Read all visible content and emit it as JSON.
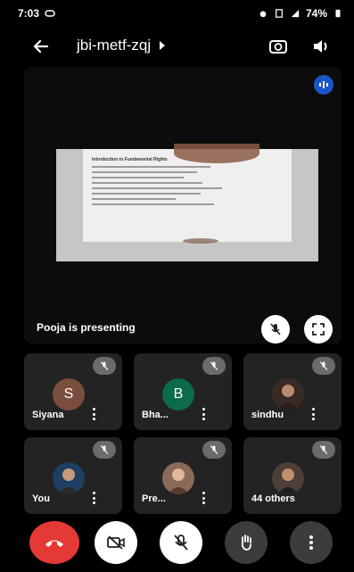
{
  "status_bar": {
    "time": "7:03",
    "battery": "74%"
  },
  "meeting": {
    "code": "jbi-metf-zqj"
  },
  "presentation": {
    "presenter_label": "Pooja is presenting",
    "slide_title": "Introduction to Fundamental Rights"
  },
  "participants": [
    {
      "name": "Siyana",
      "initial": "S",
      "avatar_color": "#7b4d3d",
      "muted": true
    },
    {
      "name": "Bha...",
      "initial": "B",
      "avatar_color": "#0c6b4a",
      "muted": true
    },
    {
      "name": "sindhu",
      "initial": "",
      "avatar_color": "#3a2a26",
      "muted": true
    },
    {
      "name": "You",
      "initial": "",
      "avatar_color": "#1e3f63",
      "muted": true
    },
    {
      "name": "Pre...",
      "initial": "",
      "avatar_color": "#8a6a58",
      "muted": true
    },
    {
      "name": "44 others",
      "initial": "",
      "avatar_color": "#4d3e37",
      "muted": true
    }
  ],
  "controls": [
    {
      "icon": "end-call-icon",
      "color": "#e53935"
    },
    {
      "icon": "camera-off-icon",
      "color": "#ffffff"
    },
    {
      "icon": "mic-off-icon",
      "color": "#ffffff"
    },
    {
      "icon": "raise-hand-icon",
      "color": "#3c3c3c"
    },
    {
      "icon": "more-options-icon",
      "color": "#3c3c3c"
    }
  ]
}
